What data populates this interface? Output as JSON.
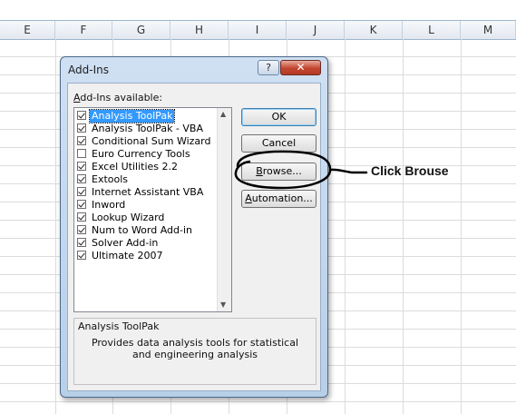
{
  "spreadsheet": {
    "columns": [
      "E",
      "F",
      "G",
      "H",
      "I",
      "J",
      "K",
      "L",
      "M"
    ]
  },
  "dialog": {
    "title": "Add-Ins",
    "help_label": "?",
    "close_label": "✕",
    "available_label": "dd-Ins available:",
    "available_accel": "A",
    "items": [
      {
        "label": "Analysis ToolPak",
        "checked": true,
        "selected": true
      },
      {
        "label": "Analysis ToolPak - VBA",
        "checked": true,
        "selected": false
      },
      {
        "label": "Conditional Sum Wizard",
        "checked": true,
        "selected": false
      },
      {
        "label": "Euro Currency Tools",
        "checked": false,
        "selected": false
      },
      {
        "label": "Excel Utilities 2.2",
        "checked": true,
        "selected": false
      },
      {
        "label": "Extools",
        "checked": true,
        "selected": false
      },
      {
        "label": "Internet Assistant VBA",
        "checked": true,
        "selected": false
      },
      {
        "label": "Inword",
        "checked": true,
        "selected": false
      },
      {
        "label": "Lookup Wizard",
        "checked": true,
        "selected": false
      },
      {
        "label": "Num to Word Add-in",
        "checked": true,
        "selected": false
      },
      {
        "label": "Solver Add-in",
        "checked": true,
        "selected": false
      },
      {
        "label": "Ultimate 2007",
        "checked": true,
        "selected": false
      }
    ],
    "buttons": {
      "ok": "OK",
      "cancel": "Cancel",
      "browse_accel": "B",
      "browse_rest": "rowse...",
      "automation_accel": "A",
      "automation_rest": "utomation..."
    },
    "description": {
      "title": "Analysis ToolPak",
      "text": "Provides data analysis tools for statistical and engineering analysis"
    }
  },
  "annotation": {
    "text": "Click Brouse"
  }
}
